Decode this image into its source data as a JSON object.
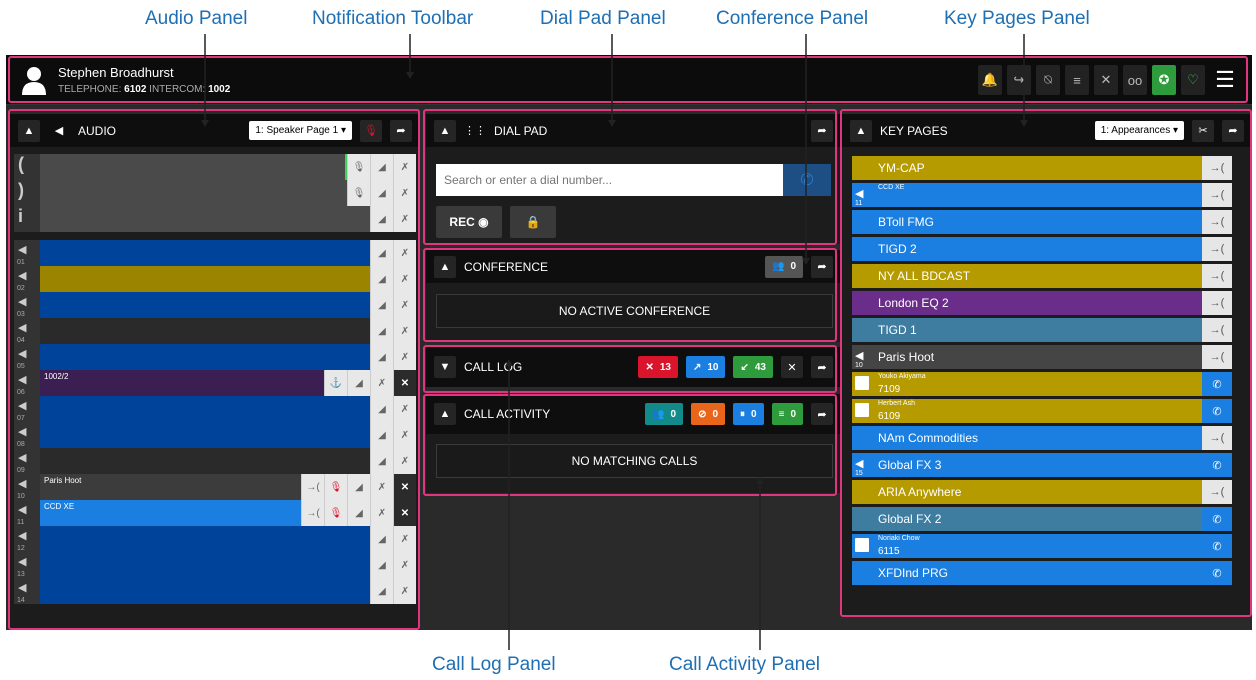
{
  "callouts": {
    "audio_panel": "Audio Panel",
    "notification_toolbar": "Notification Toolbar",
    "dial_pad_panel": "Dial Pad Panel",
    "conference_panel": "Conference Panel",
    "key_pages_panel": "Key Pages Panel",
    "call_log_panel": "Call Log Panel",
    "call_activity_panel": "Call Activity Panel"
  },
  "colors": {
    "callout": "#1e6fb3",
    "highlight": "#e0357f",
    "blue": "#1a7fe0",
    "olive": "#b59a00",
    "navy": "#00439a",
    "purple": "#6a2e8a",
    "steel": "#3f7da0",
    "green": "#2e9b3c",
    "red": "#d9142b"
  },
  "user": {
    "name": "Stephen Broadhurst",
    "telephone_label": "TELEPHONE:",
    "telephone": "6102",
    "intercom_label": "INTERCOM:",
    "intercom": "1002"
  },
  "toolbar_icons": [
    "bell-icon",
    "call-forward-icon",
    "bell-off-icon",
    "filter-icon",
    "hangup-icon",
    "voicemail-icon",
    "compass-icon",
    "heart-icon",
    "menu-icon"
  ],
  "audio": {
    "title": "AUDIO",
    "speaker_select": "1: Speaker Page 1 ▾",
    "rows": [
      {
        "label": "",
        "num": "",
        "icon": "handset-left"
      },
      {
        "label": "",
        "num": "",
        "icon": "handset-right"
      },
      {
        "label": "",
        "num": "",
        "icon": "info"
      },
      {
        "label": "",
        "num": "01",
        "icon": "speaker"
      },
      {
        "label": "",
        "num": "02",
        "icon": "speaker"
      },
      {
        "label": "",
        "num": "03",
        "icon": "speaker"
      },
      {
        "label": "",
        "num": "04",
        "icon": "speaker"
      },
      {
        "label": "",
        "num": "05",
        "icon": "speaker"
      },
      {
        "label": "1002/2",
        "num": "06",
        "icon": "speaker"
      },
      {
        "label": "",
        "num": "07",
        "icon": "speaker"
      },
      {
        "label": "",
        "num": "08",
        "icon": "speaker"
      },
      {
        "label": "",
        "num": "09",
        "icon": "speaker"
      },
      {
        "label": "Paris Hoot",
        "num": "10",
        "icon": "speaker"
      },
      {
        "label": "CCD XE",
        "num": "11",
        "icon": "speaker"
      },
      {
        "label": "",
        "num": "12",
        "icon": "speaker"
      },
      {
        "label": "",
        "num": "13",
        "icon": "speaker"
      },
      {
        "label": "",
        "num": "14",
        "icon": "speaker"
      }
    ]
  },
  "dial_pad": {
    "title": "DIAL PAD",
    "search_placeholder": "Search or enter a dial number...",
    "rec_label": "REC ◉",
    "lock_label": "🔒"
  },
  "conference": {
    "title": "CONFERENCE",
    "count": "0",
    "empty": "NO ACTIVE CONFERENCE"
  },
  "call_log": {
    "title": "CALL LOG",
    "missed": "13",
    "outgoing": "10",
    "incoming": "43"
  },
  "call_activity": {
    "title": "CALL ACTIVITY",
    "c1": "0",
    "c2": "0",
    "c3": "0",
    "c4": "0",
    "empty": "NO MATCHING CALLS"
  },
  "key_pages": {
    "title": "KEY PAGES",
    "select": "1: Appearances ▾",
    "rows": [
      {
        "label": "YM-CAP",
        "sub": "",
        "num": "",
        "kind": "olive",
        "icon": "",
        "btn": "arrow"
      },
      {
        "label": "",
        "sub": "CCD XE",
        "num": "11",
        "kind": "blue",
        "icon": "speaker",
        "btn": "arrow"
      },
      {
        "label": "BToll FMG",
        "sub": "",
        "num": "",
        "kind": "blue",
        "icon": "",
        "btn": "arrow"
      },
      {
        "label": "TIGD 2",
        "sub": "",
        "num": "",
        "kind": "blue",
        "icon": "",
        "btn": "arrow"
      },
      {
        "label": "NY ALL BDCAST",
        "sub": "",
        "num": "",
        "kind": "olive",
        "icon": "",
        "btn": "arrow"
      },
      {
        "label": "London EQ 2",
        "sub": "",
        "num": "",
        "kind": "purple",
        "icon": "",
        "btn": "arrow"
      },
      {
        "label": "TIGD 1",
        "sub": "",
        "num": "",
        "kind": "steel",
        "icon": "",
        "btn": "arrow"
      },
      {
        "label": "Paris Hoot",
        "sub": "",
        "num": "10",
        "kind": "grey",
        "icon": "speaker",
        "btn": "arrow"
      },
      {
        "label": "7109",
        "sub": "Youko Akiyama",
        "num": "",
        "kind": "olive",
        "icon": "phone",
        "btn": "phone"
      },
      {
        "label": "6109",
        "sub": "Herbert Ash",
        "num": "",
        "kind": "olive",
        "icon": "phone",
        "btn": "phone"
      },
      {
        "label": "NAm Commodities",
        "sub": "",
        "num": "",
        "kind": "blue",
        "icon": "",
        "btn": "arrow"
      },
      {
        "label": "Global FX 3",
        "sub": "",
        "num": "15",
        "kind": "blue",
        "icon": "speaker",
        "btn": "phone"
      },
      {
        "label": "ARIA Anywhere",
        "sub": "",
        "num": "",
        "kind": "olive",
        "icon": "",
        "btn": "arrow"
      },
      {
        "label": "Global FX 2",
        "sub": "",
        "num": "",
        "kind": "steel",
        "icon": "",
        "btn": "phone"
      },
      {
        "label": "6115",
        "sub": "Noriaki Chow",
        "num": "",
        "kind": "blue",
        "icon": "phone",
        "btn": "phone"
      },
      {
        "label": "XFDInd PRG",
        "sub": "",
        "num": "",
        "kind": "blue",
        "icon": "",
        "btn": "phone"
      }
    ]
  }
}
